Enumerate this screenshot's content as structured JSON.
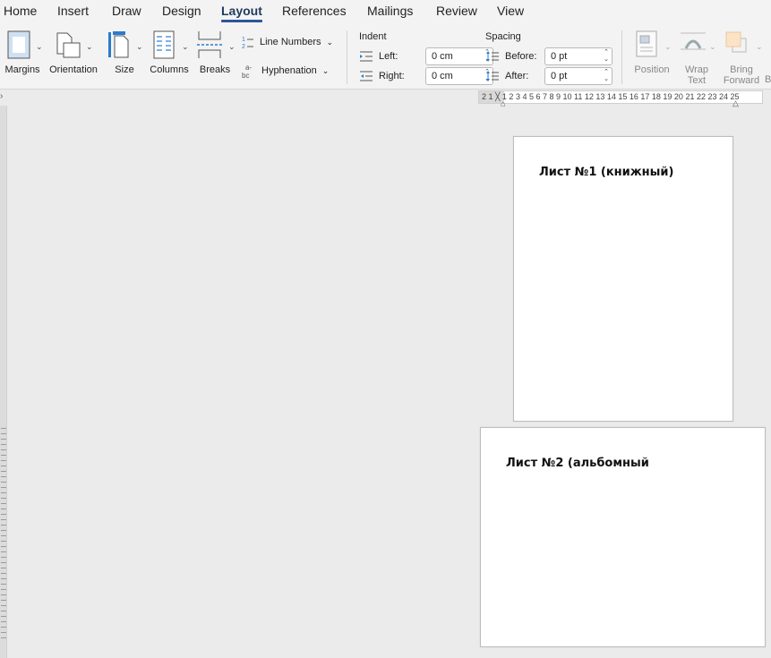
{
  "tabs": [
    {
      "label": "Home"
    },
    {
      "label": "Insert"
    },
    {
      "label": "Draw"
    },
    {
      "label": "Design"
    },
    {
      "label": "Layout",
      "active": true
    },
    {
      "label": "References"
    },
    {
      "label": "Mailings"
    },
    {
      "label": "Review"
    },
    {
      "label": "View"
    }
  ],
  "ribbon": {
    "margins": "Margins",
    "orientation": "Orientation",
    "size": "Size",
    "columns": "Columns",
    "breaks": "Breaks",
    "line_numbers": "Line Numbers",
    "hyphenation": "Hyphenation",
    "indent": {
      "title": "Indent",
      "left_label": "Left:",
      "left_value": "0 cm",
      "right_label": "Right:",
      "right_value": "0 cm"
    },
    "spacing": {
      "title": "Spacing",
      "before_label": "Before:",
      "before_value": "0 pt",
      "after_label": "After:",
      "after_value": "0 pt"
    },
    "position": "Position",
    "wrap_text": [
      "Wrap",
      "Text"
    ],
    "bring_forward": [
      "Bring",
      "Forward"
    ],
    "cut_off_letter": "B"
  },
  "ruler": {
    "numbers": "2 1 ╳ 1 2 3 4 5 6 7 8 9 10 11 12 13 14 15 16 17 18 19 20 21 22 23 24 25"
  },
  "pages": [
    {
      "text": "Лист №1 (книжный)"
    },
    {
      "text": "Лист №2 (альбомный"
    }
  ],
  "colors": {
    "accent": "#2b579a",
    "ribbon_bg": "#f3f3f3",
    "canvas_bg": "#ebebeb"
  }
}
